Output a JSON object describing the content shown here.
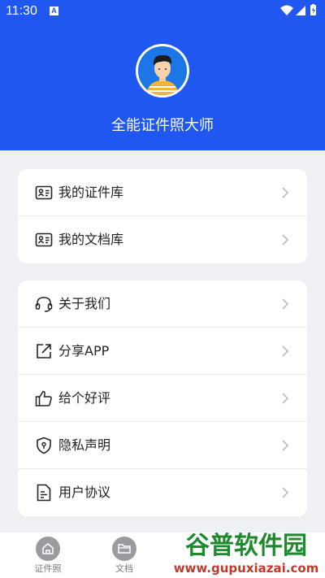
{
  "status_bar": {
    "time": "11:30",
    "notif_badge": "A"
  },
  "profile": {
    "app_name": "全能证件照大师"
  },
  "card1": {
    "items": [
      {
        "icon": "id-card-icon",
        "label": "我的证件库"
      },
      {
        "icon": "id-card-icon",
        "label": "我的文档库"
      }
    ]
  },
  "card2": {
    "items": [
      {
        "icon": "headset-icon",
        "label": "关于我们"
      },
      {
        "icon": "share-icon",
        "label": "分享APP"
      },
      {
        "icon": "thumbs-up-icon",
        "label": "给个好评"
      },
      {
        "icon": "shield-icon",
        "label": "隐私声明"
      },
      {
        "icon": "document-icon",
        "label": "用户协议"
      }
    ]
  },
  "bottom_nav": {
    "tabs": [
      {
        "icon": "home-icon",
        "label": "证件照"
      },
      {
        "icon": "folder-icon",
        "label": "文档"
      }
    ]
  },
  "watermark": {
    "line1": "谷普软件园",
    "line2": "www.gupuxiazai.com"
  },
  "colors": {
    "header_blue": "#1f57f0",
    "background": "#eef0f4"
  }
}
